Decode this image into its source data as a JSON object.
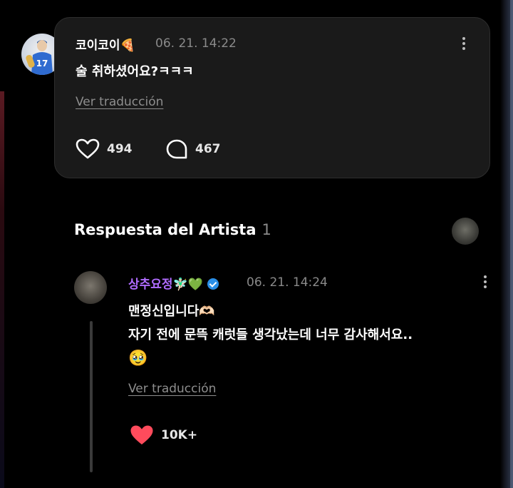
{
  "comment": {
    "username": "코이코이🍕",
    "timestamp": "06. 21. 14:22",
    "text": "술 취하셨어요?ㅋㅋㅋ",
    "translate_label": "Ver traducción",
    "likes": "494",
    "replies": "467",
    "avatar_number": "17"
  },
  "section": {
    "title": "Respuesta del Artista",
    "count": "1"
  },
  "reply": {
    "username": "상추요정🧚🏻‍♂️💚",
    "timestamp": "06. 21. 14:24",
    "line1": "맨정신입니다🫶🏻",
    "line2": "자기 전에 문뜩 캐럿들 생각났는데 너무 감사해서요..",
    "line3": "🥹",
    "translate_label": "Ver traducción",
    "likes": "10K+"
  },
  "colors": {
    "accent_username": "#b06cff",
    "liked_heart": "#ff4b5c",
    "verified": "#2a8fe8"
  },
  "icons": {
    "heart": "heart-icon",
    "comment": "comment-bubble-icon",
    "more": "more-vertical-icon",
    "verified": "verified-badge-icon"
  }
}
